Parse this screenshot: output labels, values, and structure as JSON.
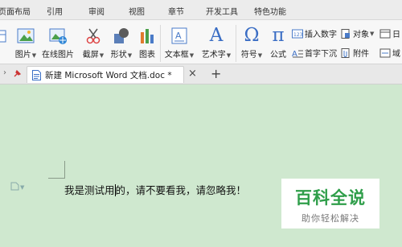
{
  "menubar": {
    "items": [
      "页面布局",
      "引用",
      "审阅",
      "视图",
      "章节",
      "开发工具",
      "特色功能"
    ]
  },
  "ribbon": {
    "image_label": "图片",
    "online_image_label": "在线图片",
    "screenshot_label": "截屏",
    "shape_label": "形状",
    "chart_label": "图表",
    "textbox_label": "文本框",
    "wordart_label": "艺术字",
    "symbol_label": "符号",
    "formula_label": "公式",
    "insert_number_label": "插入数字",
    "object_label": "对象",
    "date_label": "日",
    "dropcap_label": "首字下沉",
    "attachment_label": "附件",
    "field_label": "域",
    "formula_glyph": "π",
    "symbol_glyph": "Ω",
    "wordart_glyph": "A"
  },
  "tabbar": {
    "doc_tab_title": "新建 Microsoft Word 文档.doc *",
    "close_glyph": "×",
    "add_glyph": "+"
  },
  "document": {
    "text_before_cursor": "我是测试用",
    "text_after_cursor": "的，请不要看我，请忽略我！"
  },
  "watermark": {
    "title": "百科全说",
    "subtitle": "助你轻松解决"
  },
  "colors": {
    "doc_background": "#cfe8cf",
    "watermark_green": "#2f9e4a",
    "doc_icon_blue": "#3b6fc6"
  }
}
